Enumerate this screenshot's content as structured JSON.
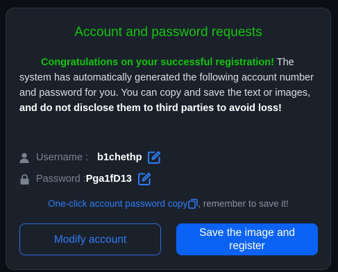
{
  "dialog": {
    "title": "Account and password requests",
    "message": {
      "highlight": "Congratulations on your successful registration!",
      "body": " The system has automatically generated the following account number and password for you. You can copy and save the text or images, ",
      "warning": "and do not disclose them to third parties to avoid loss!"
    },
    "username": {
      "icon": "user-icon",
      "label": "Username : ",
      "value": "b1chethp",
      "edit_icon": "edit-icon"
    },
    "password": {
      "icon": "lock-icon",
      "label": "Password :",
      "value": "Pga1fD13",
      "edit_icon": "edit-icon"
    },
    "copy": {
      "link": "One-click account password copy",
      "icon": "copy-icon",
      "hint": ", remember to save it!"
    },
    "buttons": {
      "modify": "Modify account",
      "save": "Save the image and register"
    }
  },
  "colors": {
    "background": "#0b0e14",
    "panel": "#1b212b",
    "title_green": "#14c40f",
    "accent_blue": "#2f7df6",
    "primary_button": "#0b63f6"
  }
}
